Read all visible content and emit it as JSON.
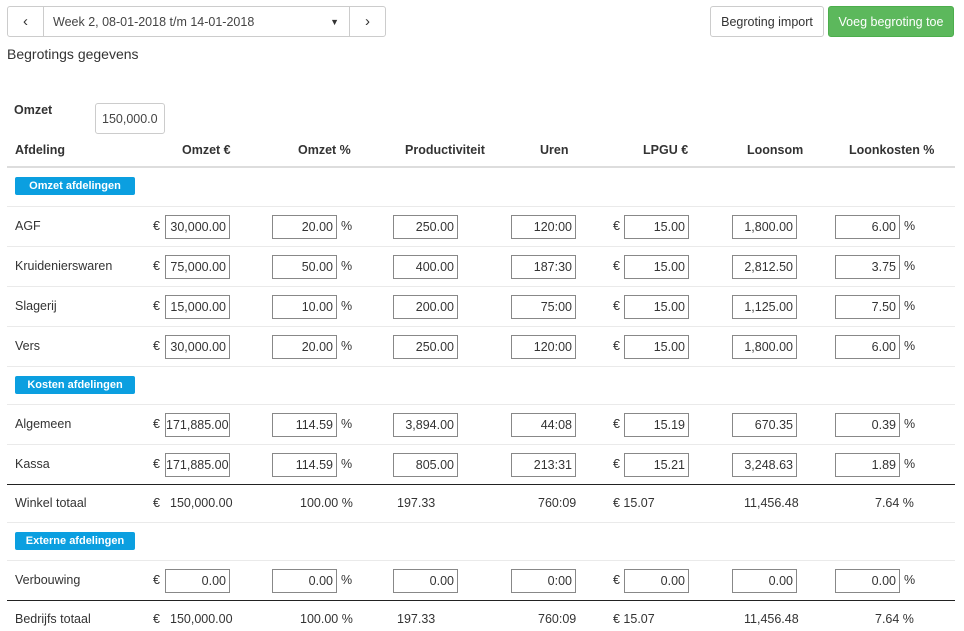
{
  "week_nav": {
    "prev": "‹",
    "next": "›",
    "selected": "Week 2, 08-01-2018 t/m 14-01-2018"
  },
  "actions": {
    "import_label": "Begroting import",
    "add_label": "Voeg begroting toe",
    "add_color": "#5cb85c"
  },
  "page_title": "Begrotings gegevens",
  "omzet": {
    "label": "Omzet",
    "value": "150,000.00"
  },
  "columns": [
    "Afdeling",
    "Omzet €",
    "Omzet %",
    "Productiviteit",
    "Uren",
    "LPGU €",
    "Loonsom",
    "Loonkosten %"
  ],
  "units": {
    "euro": "€",
    "percent": "%"
  },
  "sections": {
    "omzet": {
      "label": "Omzet afdelingen",
      "rows": [
        {
          "name": "AGF",
          "omzet": "30,000.00",
          "omzet_pct": "20.00",
          "productiviteit": "250.00",
          "uren": "120:00",
          "lpgu": "15.00",
          "loonsom": "1,800.00",
          "loonkosten_pct": "6.00"
        },
        {
          "name": "Kruidenierswaren",
          "omzet": "75,000.00",
          "omzet_pct": "50.00",
          "productiviteit": "400.00",
          "uren": "187:30",
          "lpgu": "15.00",
          "loonsom": "2,812.50",
          "loonkosten_pct": "3.75"
        },
        {
          "name": "Slagerij",
          "omzet": "15,000.00",
          "omzet_pct": "10.00",
          "productiviteit": "200.00",
          "uren": "75:00",
          "lpgu": "15.00",
          "loonsom": "1,125.00",
          "loonkosten_pct": "7.50"
        },
        {
          "name": "Vers",
          "omzet": "30,000.00",
          "omzet_pct": "20.00",
          "productiviteit": "250.00",
          "uren": "120:00",
          "lpgu": "15.00",
          "loonsom": "1,800.00",
          "loonkosten_pct": "6.00"
        }
      ]
    },
    "kosten": {
      "label": "Kosten afdelingen",
      "rows": [
        {
          "name": "Algemeen",
          "omzet": "171,885.00",
          "omzet_pct": "114.59",
          "productiviteit": "3,894.00",
          "uren": "44:08",
          "lpgu": "15.19",
          "loonsom": "670.35",
          "loonkosten_pct": "0.39"
        },
        {
          "name": "Kassa",
          "omzet": "171,885.00",
          "omzet_pct": "114.59",
          "productiviteit": "805.00",
          "uren": "213:31",
          "lpgu": "15.21",
          "loonsom": "3,248.63",
          "loonkosten_pct": "1.89"
        }
      ]
    },
    "extern": {
      "label": "Externe afdelingen",
      "rows": [
        {
          "name": "Verbouwing",
          "omzet": "0.00",
          "omzet_pct": "0.00",
          "productiviteit": "0.00",
          "uren": "0:00",
          "lpgu": "0.00",
          "loonsom": "0.00",
          "loonkosten_pct": "0.00"
        }
      ]
    }
  },
  "winkel_totaal": {
    "name": "Winkel totaal",
    "omzet": "150,000.00",
    "omzet_pct": "100.00 %",
    "productiviteit": "197.33",
    "uren": "760:09",
    "lpgu": "€ 15.07",
    "loonsom": "11,456.48",
    "loonkosten_pct": "7.64 %"
  },
  "bedrijfs_totaal": {
    "name": "Bedrijfs totaal",
    "omzet": "150,000.00",
    "omzet_pct": "100.00 %",
    "productiviteit": "197.33",
    "uren": "760:09",
    "lpgu": "€ 15.07",
    "loonsom": "11,456.48",
    "loonkosten_pct": "7.64 %"
  }
}
